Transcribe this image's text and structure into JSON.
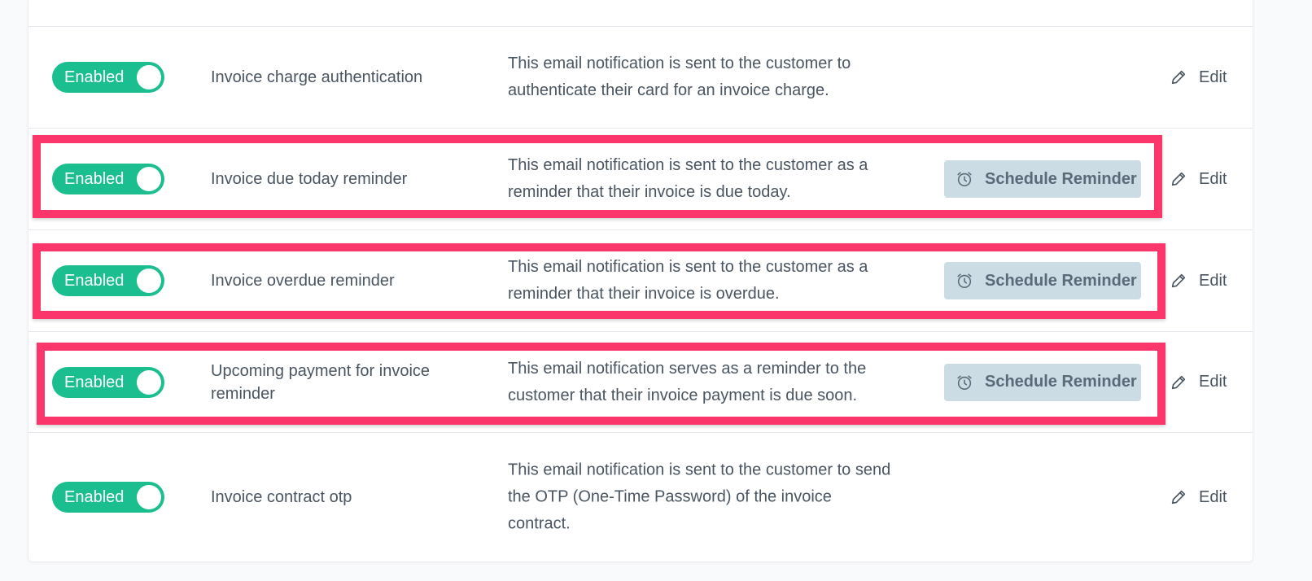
{
  "colors": {
    "toggle_on": "#1bbf8f",
    "highlight": "#fa366a",
    "schedule_button_bg": "#ccdce5",
    "text": "#4a5562"
  },
  "notifications": [
    {
      "toggle_label": "Enabled",
      "name": "Invoice charge authentication",
      "description": "This email notification is sent to the customer to authenticate their card for an invoice charge.",
      "edit_label": "Edit",
      "highlighted": false
    },
    {
      "toggle_label": "Enabled",
      "name": "Invoice due today reminder",
      "description": "This email notification is sent to the customer as a reminder that their invoice is due today.",
      "schedule_label": "Schedule Reminder",
      "schedule_icon": "alarm-clock-icon",
      "edit_label": "Edit",
      "highlighted": true
    },
    {
      "toggle_label": "Enabled",
      "name": "Invoice overdue reminder",
      "description": "This email notification is sent to the customer as a reminder that their invoice is overdue.",
      "schedule_label": "Schedule Reminder",
      "schedule_icon": "alarm-clock-icon",
      "edit_label": "Edit",
      "highlighted": true
    },
    {
      "toggle_label": "Enabled",
      "name": "Upcoming payment for invoice reminder",
      "description": "This email notification serves as a reminder to the customer that their invoice payment is due soon.",
      "schedule_label": "Schedule Reminder",
      "schedule_icon": "alarm-clock-icon",
      "edit_label": "Edit",
      "highlighted": true
    },
    {
      "toggle_label": "Enabled",
      "name": "Invoice contract otp",
      "description": "This email notification is sent to the customer to send the OTP (One-Time Password) of the invoice contract.",
      "edit_label": "Edit",
      "highlighted": false
    }
  ]
}
